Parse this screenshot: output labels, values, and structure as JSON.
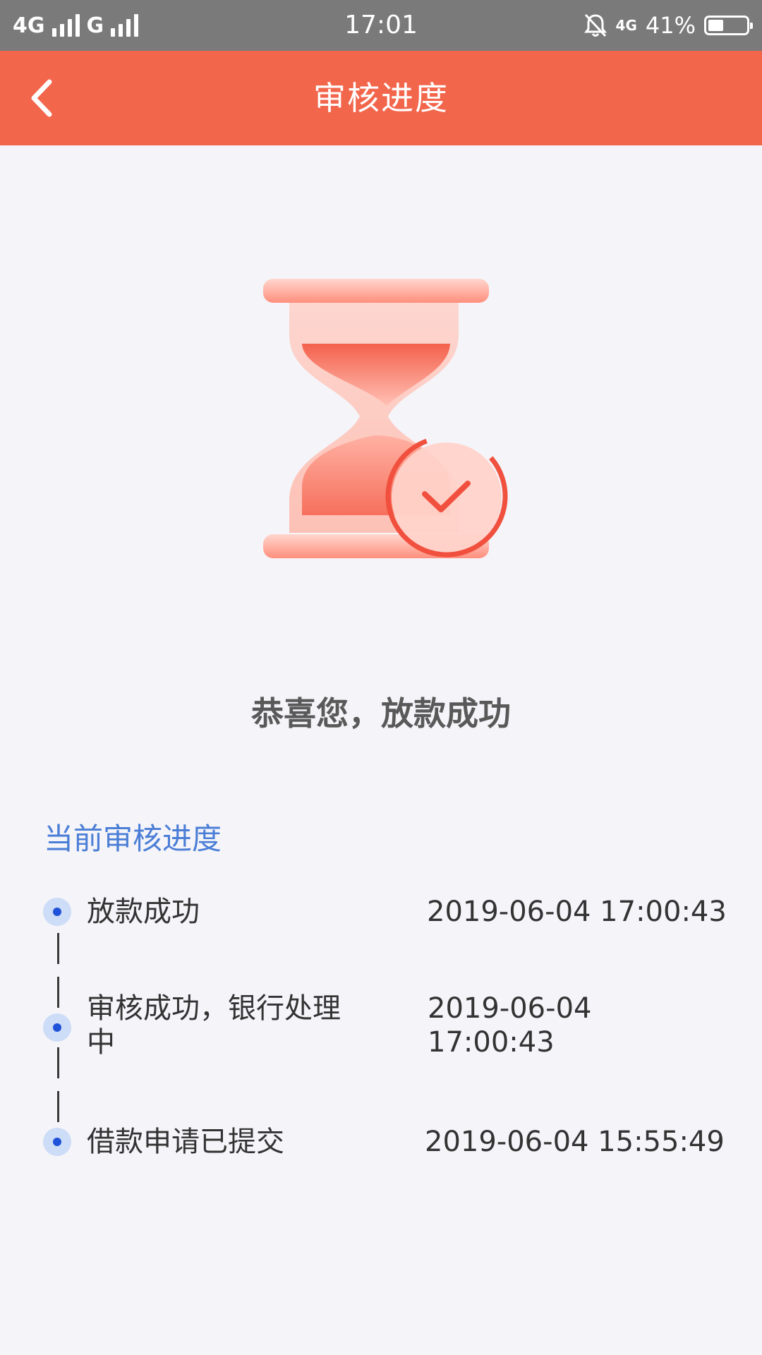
{
  "status_bar": {
    "network_left": "4G",
    "network_second": "G",
    "time": "17:01",
    "network_right": "4G",
    "battery": "41%",
    "battery_level": 0.41
  },
  "header": {
    "title": "审核进度"
  },
  "result": {
    "message": "恭喜您，放款成功"
  },
  "progress": {
    "section_title": "当前审核进度",
    "steps": [
      {
        "label": "放款成功",
        "time": "2019-06-04 17:00:43"
      },
      {
        "label_line1": "审核成功，银行处理",
        "label_line2": "中",
        "time_line1": "2019-06-04",
        "time_line2": "17:00:43"
      },
      {
        "label": "借款申请已提交",
        "time": "2019-06-04 15:55:49"
      }
    ]
  },
  "colors": {
    "header_bg": "#f2664c",
    "accent_blue": "#4b7ed6",
    "dot_blue": "#1f52d8"
  },
  "icons": [
    "back-arrow-icon",
    "hourglass-check-illustration",
    "signal-icon",
    "mute-bell-icon",
    "battery-icon"
  ]
}
